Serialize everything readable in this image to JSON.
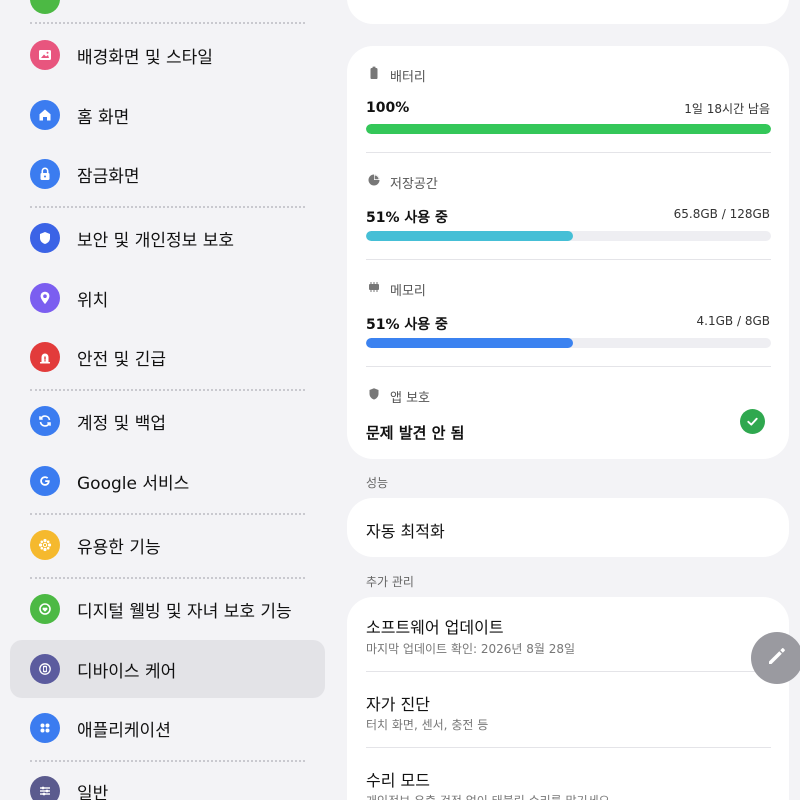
{
  "left_menu": {
    "items": [
      {
        "label": "배경화면 및 스타일",
        "icon": "wallpaper-icon",
        "color": "#e8557e"
      },
      {
        "label": "홈 화면",
        "icon": "home-icon",
        "color": "#3b7cf0"
      },
      {
        "label": "잠금화면",
        "icon": "lock-icon",
        "color": "#3b7cf0"
      },
      {
        "label": "보안 및 개인정보 보호",
        "icon": "shield-icon",
        "color": "#3b63e6"
      },
      {
        "label": "위치",
        "icon": "location-icon",
        "color": "#7b5ef0"
      },
      {
        "label": "안전 및 긴급",
        "icon": "emergency-icon",
        "color": "#e23b3b"
      },
      {
        "label": "계정 및 백업",
        "icon": "sync-icon",
        "color": "#3b7cf0"
      },
      {
        "label": "Google 서비스",
        "icon": "google-icon",
        "color": "#3b7cf0"
      },
      {
        "label": "유용한 기능",
        "icon": "puzzle-icon",
        "color": "#f5b92e"
      },
      {
        "label": "디지털 웰빙 및 자녀 보호 기능",
        "icon": "wellbeing-icon",
        "color": "#4cb944"
      },
      {
        "label": "디바이스 케어",
        "icon": "device-care-icon",
        "color": "#5b5b9e"
      },
      {
        "label": "애플리케이션",
        "icon": "apps-icon",
        "color": "#3b7cf0"
      },
      {
        "label": "일반",
        "icon": "sliders-icon",
        "color": "#5b5b8e"
      }
    ],
    "selected_index": 10
  },
  "status_card": {
    "battery": {
      "header": "배터리",
      "value": "100%",
      "remaining": "1일 18시간 남음",
      "percent": 100,
      "color": "#34c759"
    },
    "storage": {
      "header": "저장공간",
      "value": "51% 사용 중",
      "detail": "65.8GB / 128GB",
      "percent": 51,
      "color": "#45bfd6"
    },
    "memory": {
      "header": "메모리",
      "value": "51% 사용 중",
      "detail": "4.1GB / 8GB",
      "percent": 51,
      "color": "#3b82f0"
    },
    "app_protection": {
      "header": "앱 보호",
      "value": "문제 발견 안 됨",
      "status_color": "#2fa84f"
    }
  },
  "performance": {
    "section_label": "성능",
    "auto_optimize": "자동 최적화"
  },
  "extra": {
    "section_label": "추가 관리",
    "items": [
      {
        "title": "소프트웨어 업데이트",
        "subtitle": "마지막 업데이트 확인: 2026년 8월 28일"
      },
      {
        "title": "자가 진단",
        "subtitle": "터치 화면, 센서, 충전 등"
      },
      {
        "title": "수리 모드",
        "subtitle": "개인정보 유출 걱정 없이 태블릿 수리를 맡기세요"
      }
    ]
  },
  "fab": {
    "icon": "pencil-icon"
  }
}
